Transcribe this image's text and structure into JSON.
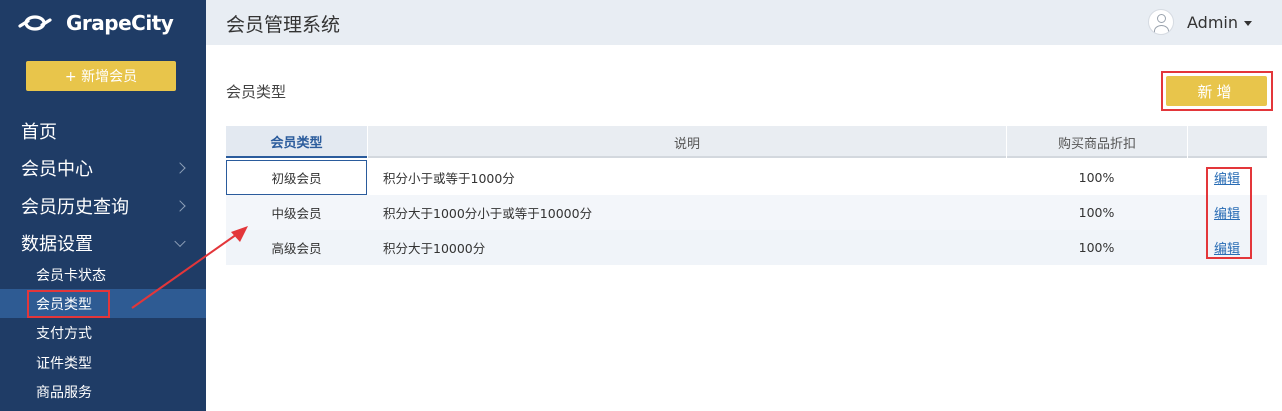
{
  "brand": {
    "logo_text": "GrapeCity"
  },
  "sidebar": {
    "new_member_label": "+ 新增会员",
    "items": [
      {
        "label": "首页",
        "chevron": "none"
      },
      {
        "label": "会员中心",
        "chevron": "right"
      },
      {
        "label": "会员历史查询",
        "chevron": "right"
      },
      {
        "label": "数据设置",
        "chevron": "down"
      }
    ],
    "sub_items": [
      {
        "label": "会员卡状态"
      },
      {
        "label": "会员类型",
        "active": true
      },
      {
        "label": "支付方式"
      },
      {
        "label": "证件类型"
      },
      {
        "label": "商品服务"
      }
    ]
  },
  "header": {
    "title": "会员管理系统",
    "user": "Admin"
  },
  "main": {
    "section_title": "会员类型",
    "add_label": "新增",
    "table": {
      "columns": [
        "会员类型",
        "说明",
        "购买商品折扣",
        ""
      ],
      "rows": [
        {
          "type": "初级会员",
          "desc": "积分小于或等于1000分",
          "discount": "100%",
          "action": "编辑"
        },
        {
          "type": "中级会员",
          "desc": "积分大于1000分小于或等于10000分",
          "discount": "100%",
          "action": "编辑"
        },
        {
          "type": "高级会员",
          "desc": "积分大于10000分",
          "discount": "100%",
          "action": "编辑"
        }
      ]
    }
  },
  "colors": {
    "sidebar_bg": "#1f3c66",
    "accent_yellow": "#e8c54b",
    "highlight_red": "#e3363a",
    "link_blue": "#2a6db5",
    "active_item_bg": "#2e5b93"
  }
}
